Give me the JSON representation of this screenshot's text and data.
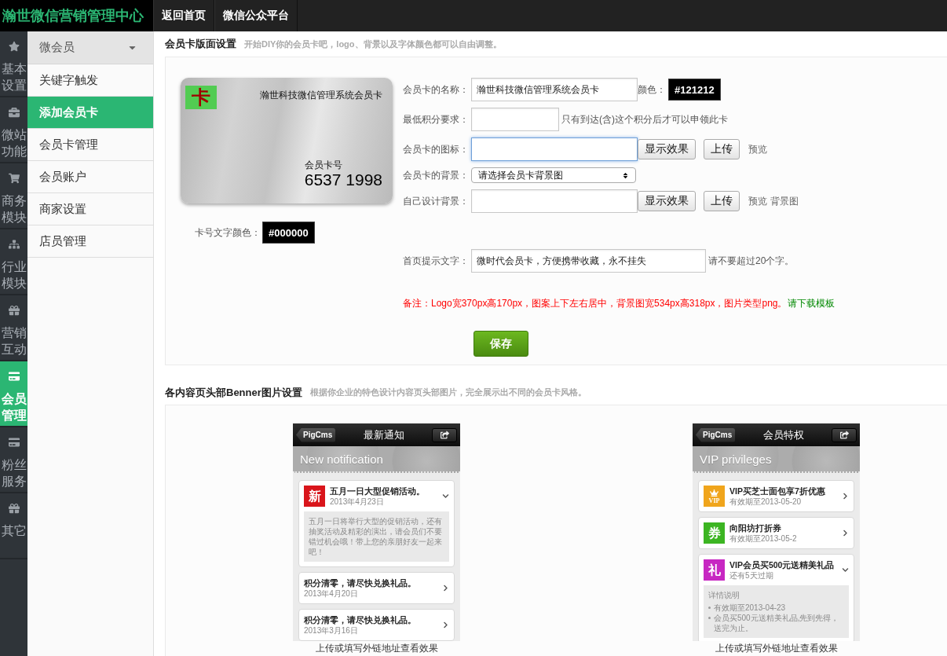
{
  "top_bar": {
    "logo": "瀚世微信营销管理中心",
    "links": [
      "返回首页",
      "微信公众平台"
    ]
  },
  "icon_sidebar": [
    {
      "label": "基本设置",
      "selected": false
    },
    {
      "label": "微站功能",
      "selected": false
    },
    {
      "label": "商务模块",
      "selected": false
    },
    {
      "label": "行业模块",
      "selected": false
    },
    {
      "label": "营销互动",
      "selected": false
    },
    {
      "label": "会员管理",
      "selected": true
    },
    {
      "label": "粉丝服务",
      "selected": false
    },
    {
      "label": "其它",
      "selected": false
    }
  ],
  "sub_menu": {
    "title": "微会员",
    "items": [
      {
        "label": "关键字触发",
        "selected": false
      },
      {
        "label": "添加会员卡",
        "selected": true
      },
      {
        "label": "会员卡管理",
        "selected": false
      },
      {
        "label": "会员账户",
        "selected": false
      },
      {
        "label": "商家设置",
        "selected": false
      },
      {
        "label": "店员管理",
        "selected": false
      }
    ]
  },
  "card_section": {
    "title": "会员卡版面设置",
    "subtitle": "开始DIY你的会员卡吧，logo、背景以及字体颜色都可以自由调整。",
    "card_preview": {
      "logo": "卡",
      "name": "瀚世科技微信管理系统会员卡",
      "number_label": "会员卡号",
      "number": "6537 1998"
    },
    "number_color": {
      "label": "卡号文字颜色：",
      "value": "#000000"
    },
    "rows": [
      {
        "kind": "name",
        "label": "会员卡的名称：",
        "value": "瀚世科技微信管理系统会员卡",
        "color_label": "颜色：",
        "color_value": "#121212"
      },
      {
        "kind": "points",
        "label": "最低积分要求：",
        "hint": "只有到达(含)这个积分后才可以申领此卡"
      },
      {
        "kind": "upload",
        "label": "会员卡的图标：",
        "focused": true,
        "buttons": [
          "显示效果",
          "上传"
        ],
        "links": [
          "预览"
        ]
      },
      {
        "kind": "select",
        "label": "会员卡的背景：",
        "value": "请选择会员卡背景图"
      },
      {
        "kind": "upload",
        "label": "自己设计背景：",
        "focused": false,
        "buttons": [
          "显示效果",
          "上传"
        ],
        "links": [
          "预览",
          "背景图"
        ]
      },
      {
        "kind": "tip",
        "label": "首页提示文字：",
        "value": "微时代会员卡，方便携带收藏，永不挂失",
        "hint": "请不要超过20个字。"
      }
    ],
    "note": {
      "text": "备注：Logo宽370px高170px，图案上下左右居中，背景图宽534px高318px，图片类型png。",
      "link": "请下载模板"
    },
    "save_button": "保存"
  },
  "banner_section": {
    "title": "各内容页头部Benner图片设置",
    "subtitle": "根据你企业的特色设计内容页头部图片，完全展示出不同的会员卡风格。",
    "previews": [
      {
        "back": "PigCms",
        "title": "最新通知",
        "banner": "New notification",
        "items": [
          {
            "badge": "新",
            "color": "#d9151b",
            "crown": false,
            "title": "五月一日大型促销活动。",
            "date": "2013年4月23日",
            "expanded": true,
            "detail_text": "五月一日将举行大型的促销活动，还有抽奖活动及精彩的演出，请会员们不要错过机会哦！带上您的亲朋好友一起来吧！"
          },
          {
            "title": "积分清零，请尽快兑换礼品。",
            "date": "2013年4月20日",
            "expanded": false
          },
          {
            "title": "积分清零，请尽快兑换礼品。",
            "date": "2013年3月16日",
            "expanded": false
          }
        ],
        "caption": "上传或填写外链地址查看效果"
      },
      {
        "back": "PigCms",
        "title": "会员特权",
        "banner": "VIP privileges",
        "items": [
          {
            "badge": "VIP",
            "color": "#f0a51c",
            "crown": true,
            "title": "VIP买芝士面包享7折优惠",
            "date": "有效期至2013-05-20",
            "expanded": false
          },
          {
            "badge": "券",
            "color": "#3cb522",
            "crown": false,
            "title": "向阳坊打折券",
            "date": "有效期至2013-05-2",
            "expanded": false
          },
          {
            "badge": "礼",
            "color": "#c727c2",
            "crown": false,
            "title": "VIP会员买500元送精美礼品",
            "date": "还有5天过期",
            "expanded": true,
            "detail_heading": "详情说明",
            "detail_bullets": [
              "有效期至2013-04-23",
              "会员买500元送精美礼品,先到先得，送完为止。"
            ]
          }
        ],
        "caption": "上传或填写外链地址查看效果"
      }
    ]
  }
}
